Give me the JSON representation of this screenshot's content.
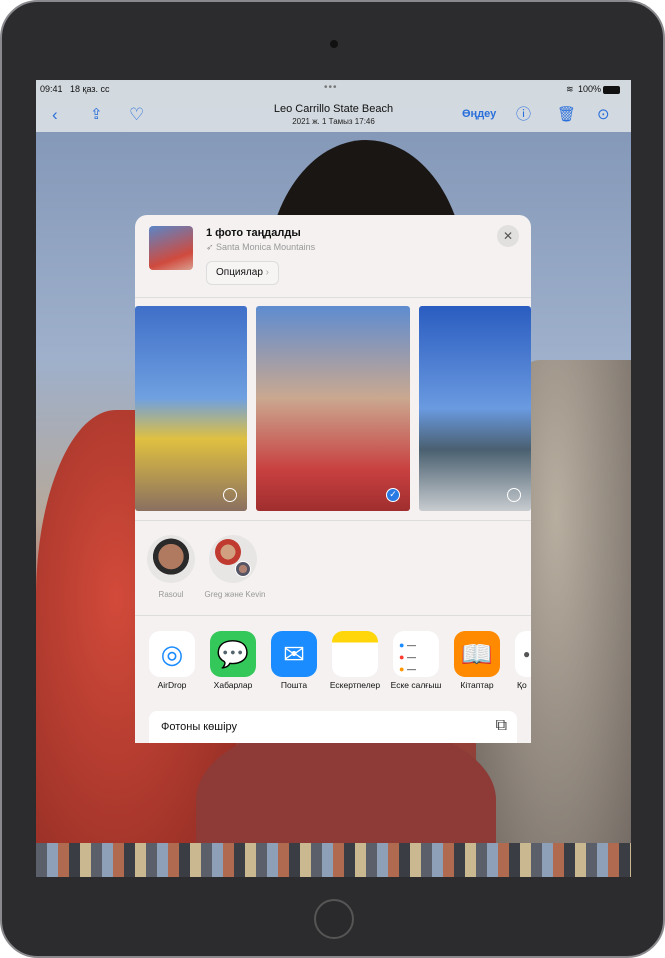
{
  "status": {
    "time": "09:41",
    "date": "18 қаз. сс",
    "battery": "100%"
  },
  "toolbar": {
    "title": "Leo Carrillo State Beach",
    "subtitle": "2021 ж. 1 Тамыз  17:46",
    "edit_label": "Өңдеу"
  },
  "share_sheet": {
    "selection_title": "1 фото таңдалды",
    "location": "Santa Monica Mountains",
    "options_label": "Опциялар",
    "photos_selected": [
      false,
      true,
      false
    ],
    "people": [
      {
        "name": "Rasoul"
      },
      {
        "name": "Greg және Kevin"
      }
    ],
    "apps": [
      {
        "label": "AirDrop",
        "icon": "airdrop-icon",
        "color": "#ffffff"
      },
      {
        "label": "Хабарлар",
        "icon": "messages-icon",
        "color": "#34c759"
      },
      {
        "label": "Пошта",
        "icon": "mail-icon",
        "color": "#1a8cff"
      },
      {
        "label": "Ескертпелер",
        "icon": "notes-icon",
        "color": "#ffffff"
      },
      {
        "label": "Еске салғыш",
        "icon": "reminders-icon",
        "color": "#ffffff"
      },
      {
        "label": "Кітаптар",
        "icon": "books-icon",
        "color": "#ff8a00"
      },
      {
        "label": "Қо",
        "icon": "more-icon",
        "color": "#ffffff"
      }
    ],
    "copy_label": "Фотоны көшіру"
  },
  "accent": "#2a6fdb"
}
